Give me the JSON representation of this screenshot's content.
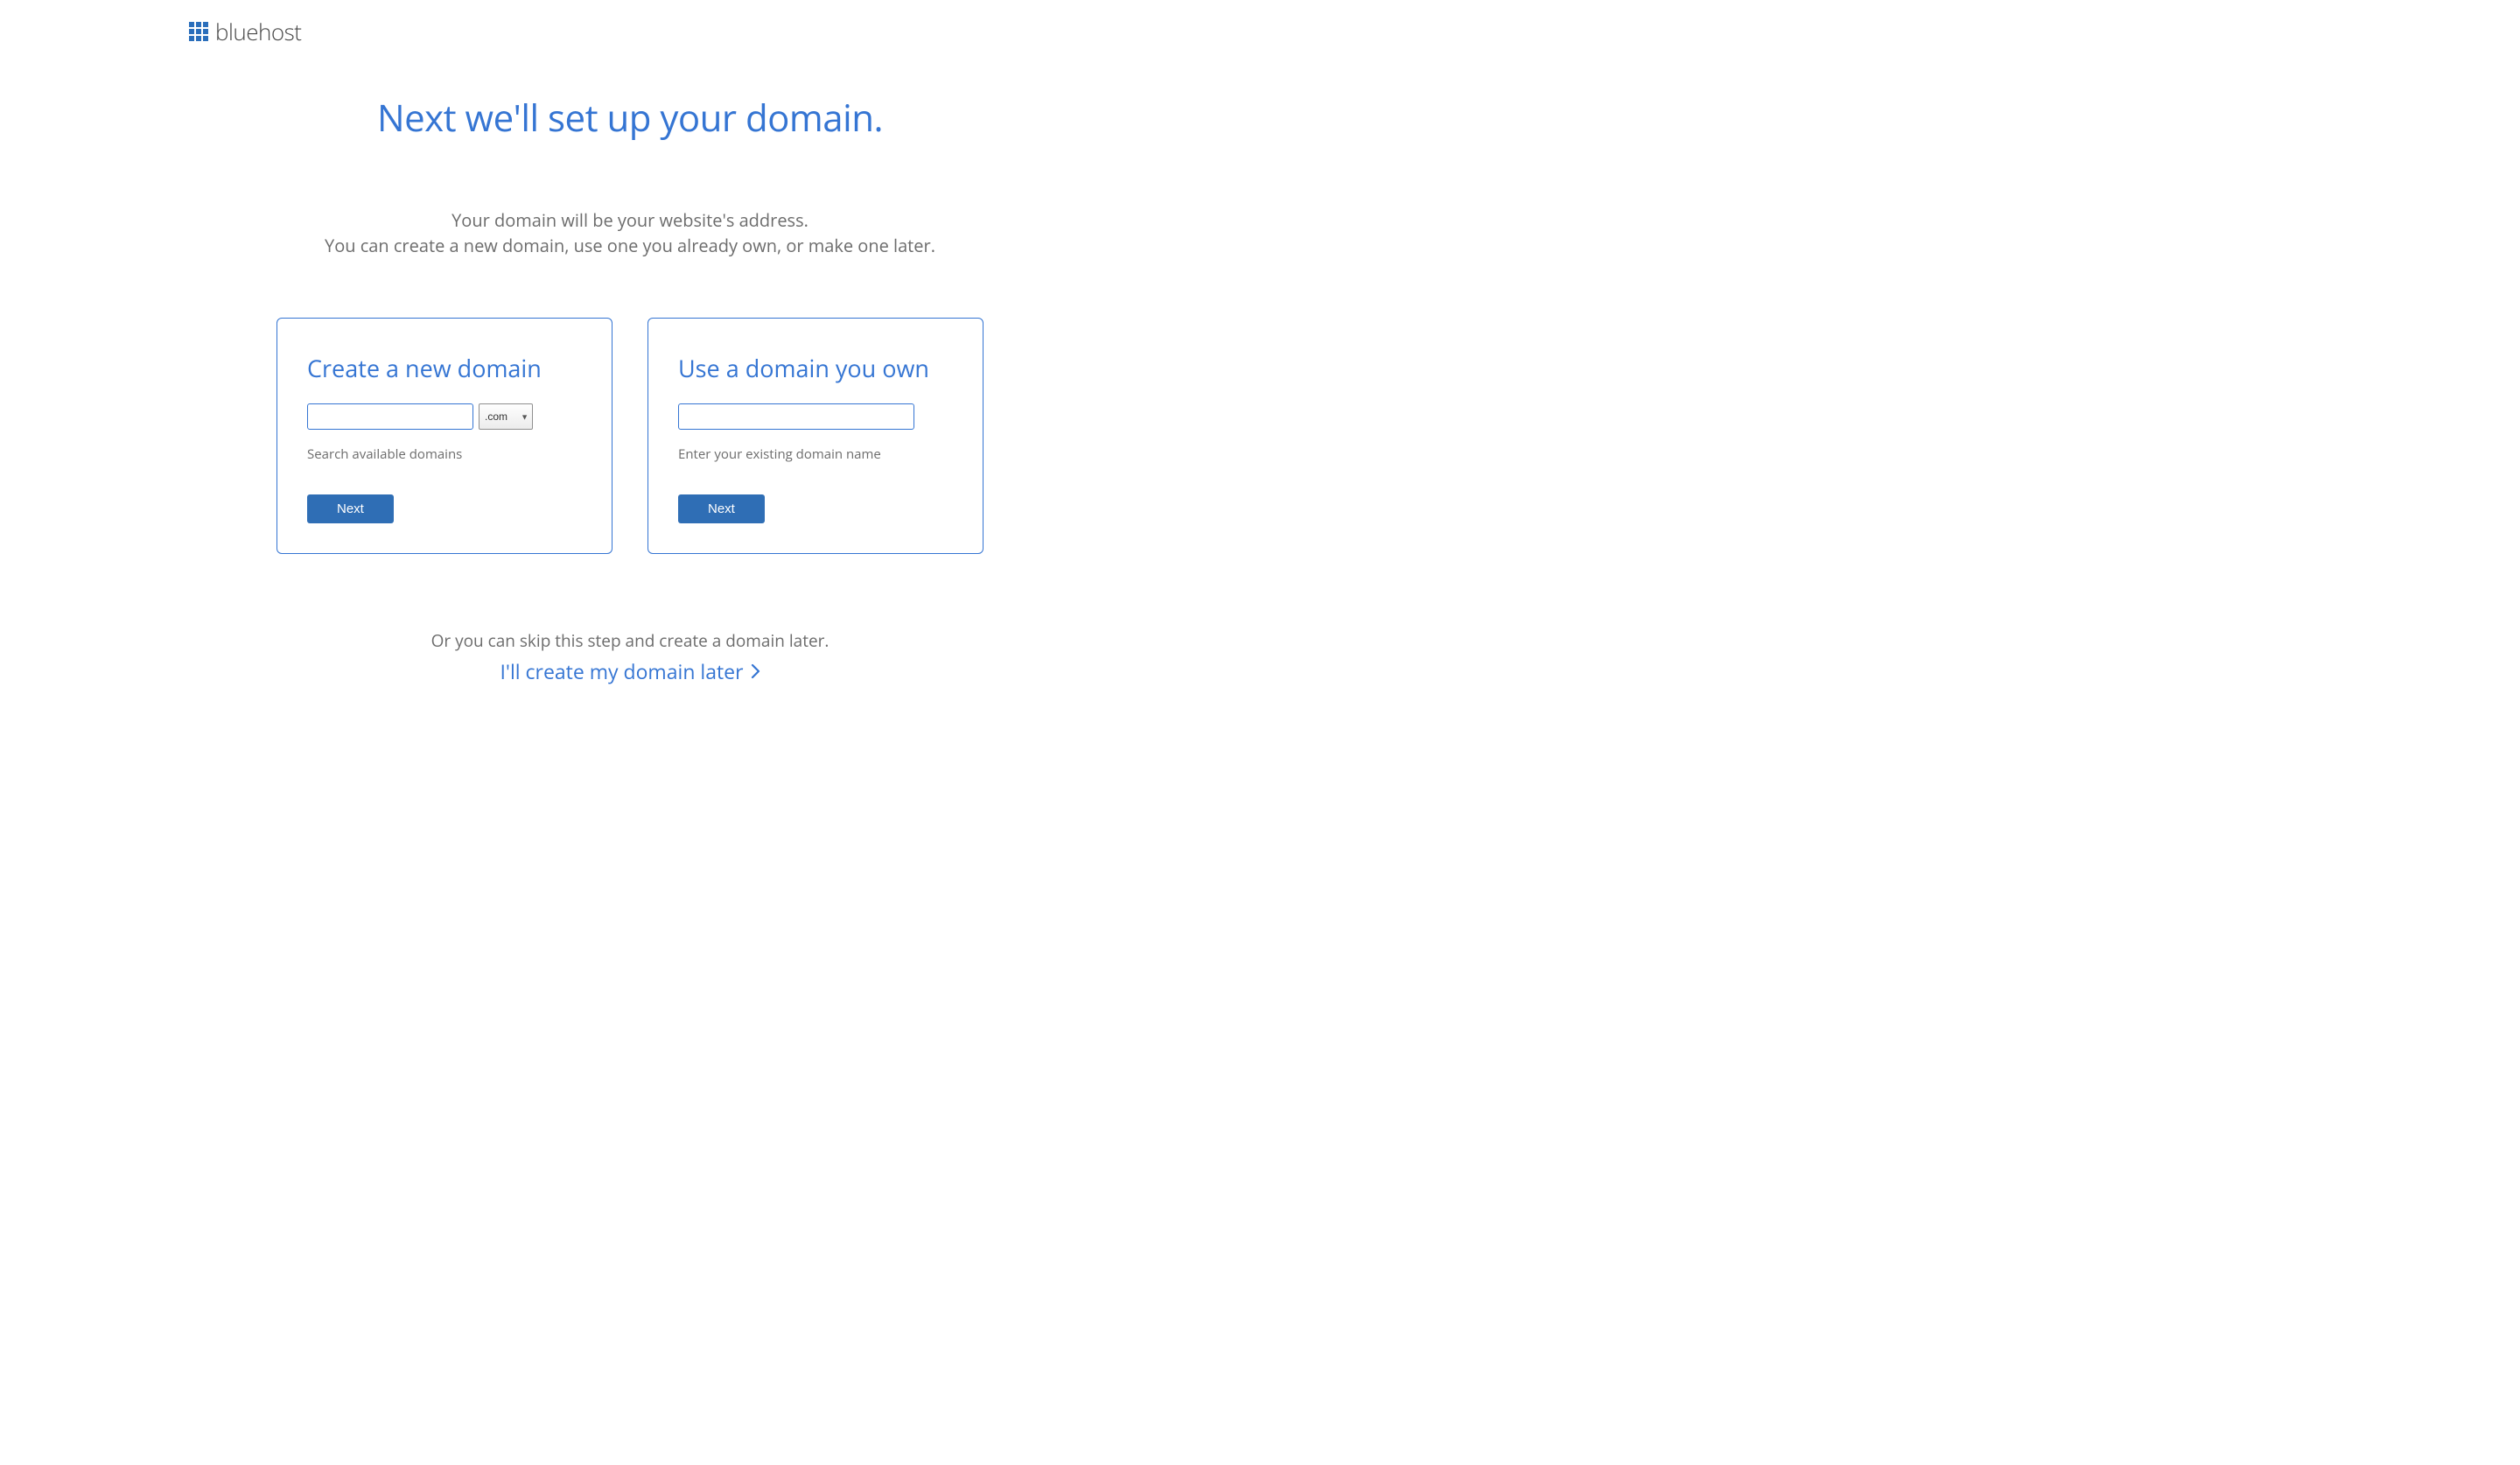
{
  "brand": {
    "name": "bluehost"
  },
  "heading": "Next we'll set up your domain.",
  "subtext_line1": "Your domain will be your website's address.",
  "subtext_line2": "You can create a new domain, use one you already own, or make one later.",
  "panel_create": {
    "title": "Create a new domain",
    "input_value": "",
    "tld_selected": ".com",
    "helper": "Search available domains",
    "button": "Next"
  },
  "panel_own": {
    "title": "Use a domain you own",
    "input_value": "",
    "helper": "Enter your existing domain name",
    "button": "Next"
  },
  "skip": {
    "pretext": "Or you can skip this step and create a domain later.",
    "link": "I'll create my domain later"
  }
}
